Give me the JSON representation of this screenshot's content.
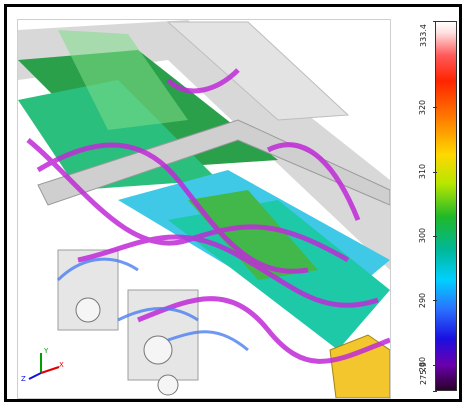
{
  "colorbar": {
    "ticks": [
      {
        "label": "333.4",
        "value": 333.4
      },
      {
        "label": "320",
        "value": 320
      },
      {
        "label": "310",
        "value": 310
      },
      {
        "label": "300",
        "value": 300
      },
      {
        "label": "290",
        "value": 290
      },
      {
        "label": "280",
        "value": 280
      },
      {
        "label": "275.9",
        "value": 275.9
      }
    ],
    "min": 275.9,
    "max": 333.4
  },
  "axes_triad": {
    "x": "X",
    "y": "Y",
    "z": "Z"
  },
  "colors": {
    "streamline": "#c02ad8",
    "wall": "#dcdcdc",
    "door": "#f2c62c"
  }
}
